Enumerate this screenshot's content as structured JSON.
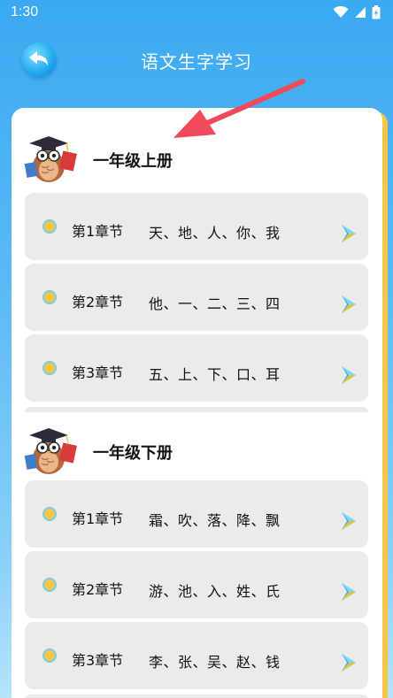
{
  "status_bar": {
    "time": "1:30"
  },
  "header": {
    "title": "语文生字学习"
  },
  "sections": [
    {
      "title": "一年级上册",
      "chapters": [
        {
          "label": "第1章节",
          "words": "天、地、人、你、我"
        },
        {
          "label": "第2章节",
          "words": "他、一、二、三、四"
        },
        {
          "label": "第3章节",
          "words": "五、上、下、口、耳"
        }
      ]
    },
    {
      "title": "一年级下册",
      "chapters": [
        {
          "label": "第1章节",
          "words": "霜、吹、落、降、飘"
        },
        {
          "label": "第2章节",
          "words": "游、池、入、姓、氏"
        },
        {
          "label": "第3章节",
          "words": "李、张、吴、赵、钱"
        }
      ]
    }
  ],
  "colors": {
    "accent_blue": "#1ea6ee",
    "card_border": "#f6c64a",
    "annotation_arrow": "#f04a5a"
  }
}
